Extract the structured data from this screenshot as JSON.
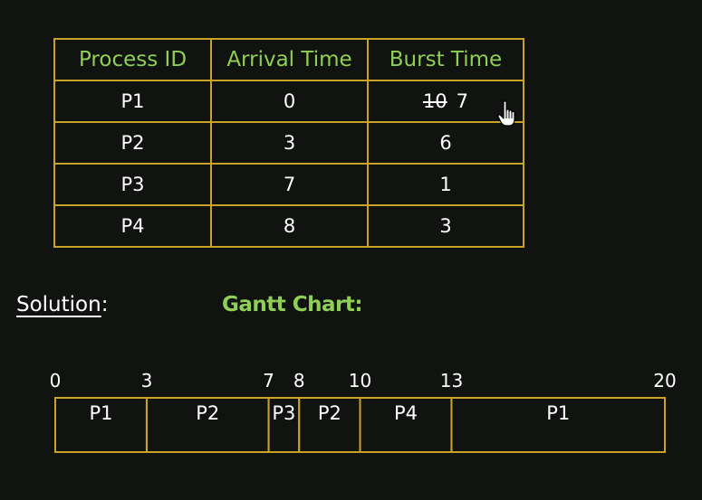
{
  "table": {
    "headers": [
      "Process ID",
      "Arrival Time",
      "Burst Time"
    ],
    "rows": [
      {
        "pid": "P1",
        "arrival": "0",
        "burst_struck": "10",
        "burst": "7"
      },
      {
        "pid": "P2",
        "arrival": "3",
        "burst": "6"
      },
      {
        "pid": "P3",
        "arrival": "7",
        "burst": "1"
      },
      {
        "pid": "P4",
        "arrival": "8",
        "burst": "3"
      }
    ]
  },
  "solution_label": "Solution",
  "solution_colon": ":",
  "gantt_title": "Gantt Chart:",
  "chart_data": {
    "type": "gantt",
    "time_start": 0,
    "time_end": 20,
    "segments": [
      {
        "label": "P1",
        "start": 0,
        "end": 3
      },
      {
        "label": "P2",
        "start": 3,
        "end": 7
      },
      {
        "label": "P3",
        "start": 7,
        "end": 8
      },
      {
        "label": "P2",
        "start": 8,
        "end": 10
      },
      {
        "label": "P4",
        "start": 10,
        "end": 13
      },
      {
        "label": "P1",
        "start": 13,
        "end": 20
      }
    ],
    "ticks": [
      "0",
      "3",
      "7",
      "8",
      "10",
      "13",
      "20"
    ]
  },
  "colors": {
    "background": "#111311",
    "border": "#c9a227",
    "header_text": "#8fcf55",
    "body_text": "#ffffff"
  },
  "icons": {
    "cursor": "hand-pointer-icon"
  }
}
